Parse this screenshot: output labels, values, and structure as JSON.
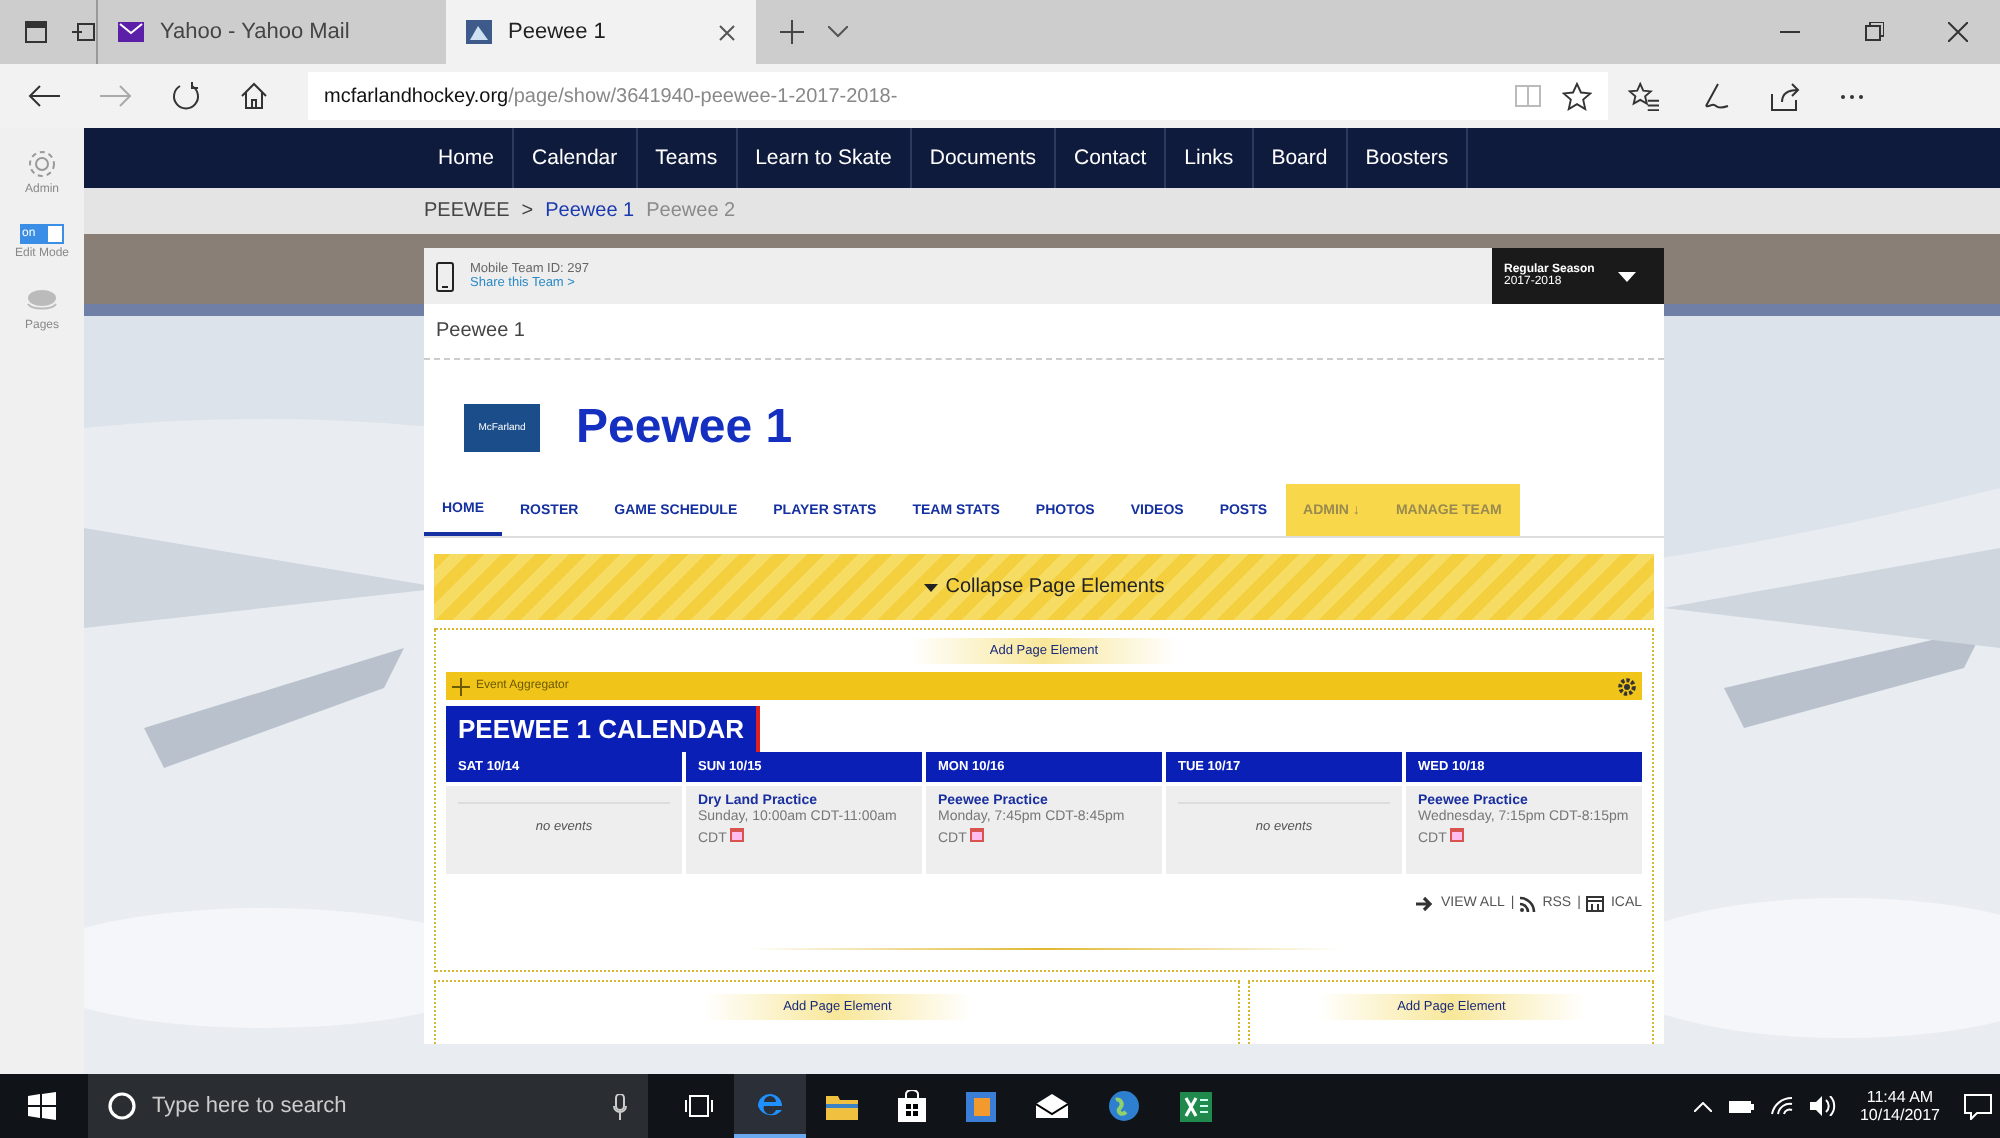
{
  "browser": {
    "tabs": [
      {
        "title": "Yahoo - Yahoo Mail",
        "selected": false
      },
      {
        "title": "Peewee 1",
        "selected": true
      }
    ],
    "url": {
      "domain": "mcfarlandhockey.org",
      "path": "/page/show/3641940-peewee-1-2017-2018-"
    }
  },
  "sidebar": {
    "items": [
      {
        "label": "Admin",
        "kind": "gear"
      },
      {
        "label": "Edit Mode",
        "kind": "toggle",
        "on": true,
        "toggle_text": "on"
      },
      {
        "label": "Pages",
        "kind": "pages"
      }
    ]
  },
  "site_nav": {
    "items": [
      "Home",
      "Calendar",
      "Teams",
      "Learn to Skate",
      "Documents",
      "Contact",
      "Links",
      "Board",
      "Boosters"
    ]
  },
  "breadcrumb": {
    "separator": ">",
    "items": [
      {
        "label": "PEEWEE",
        "kind": "parent"
      },
      {
        "label": "Peewee 1",
        "kind": "current"
      },
      {
        "label": "Peewee 2",
        "kind": "sibling"
      }
    ]
  },
  "team_bar": {
    "mobile_id": "Mobile Team ID: 297",
    "share": "Share this Team >",
    "season": {
      "label": "Regular Season",
      "years": "2017-2018"
    }
  },
  "page_title": "Peewee 1",
  "team": {
    "logo_text": "McFarland",
    "name": "Peewee 1"
  },
  "team_tabs": [
    {
      "label": "HOME",
      "selected": true,
      "kind": "normal"
    },
    {
      "label": "ROSTER",
      "selected": false,
      "kind": "normal"
    },
    {
      "label": "GAME SCHEDULE",
      "selected": false,
      "kind": "normal"
    },
    {
      "label": "PLAYER STATS",
      "selected": false,
      "kind": "normal"
    },
    {
      "label": "TEAM STATS",
      "selected": false,
      "kind": "normal"
    },
    {
      "label": "PHOTOS",
      "selected": false,
      "kind": "normal"
    },
    {
      "label": "VIDEOS",
      "selected": false,
      "kind": "normal"
    },
    {
      "label": "POSTS",
      "selected": false,
      "kind": "normal"
    },
    {
      "label": "ADMIN ↓",
      "selected": false,
      "kind": "admin"
    },
    {
      "label": "MANAGE TEAM",
      "selected": false,
      "kind": "admin"
    }
  ],
  "collapse_bar": "Collapse Page Elements",
  "add_element": [
    "Add Page Element",
    "Add Page Element",
    "Add Page Element"
  ],
  "event_aggregator": {
    "label": "Event Aggregator",
    "calendar_title": "PEEWEE 1 CALENDAR",
    "days": [
      {
        "date": "SAT 10/14",
        "empty_text": "no events"
      },
      {
        "date": "SUN 10/15",
        "events": [
          {
            "title": "Dry Land Practice",
            "time": "Sunday, 10:00am CDT-11:00am CDT"
          }
        ]
      },
      {
        "date": "MON 10/16",
        "events": [
          {
            "title": "Peewee Practice",
            "time": "Monday, 7:45pm CDT-8:45pm CDT"
          }
        ]
      },
      {
        "date": "TUE 10/17",
        "empty_text": "no events"
      },
      {
        "date": "WED 10/18",
        "events": [
          {
            "title": "Peewee Practice",
            "time": "Wednesday, 7:15pm CDT-8:15pm CDT"
          }
        ]
      }
    ],
    "links": [
      "VIEW ALL",
      "RSS",
      "ICAL"
    ],
    "link_separator": "|"
  },
  "taskbar": {
    "search_placeholder": "Type here to search",
    "time": "11:44 AM",
    "date": "10/14/2017"
  }
}
